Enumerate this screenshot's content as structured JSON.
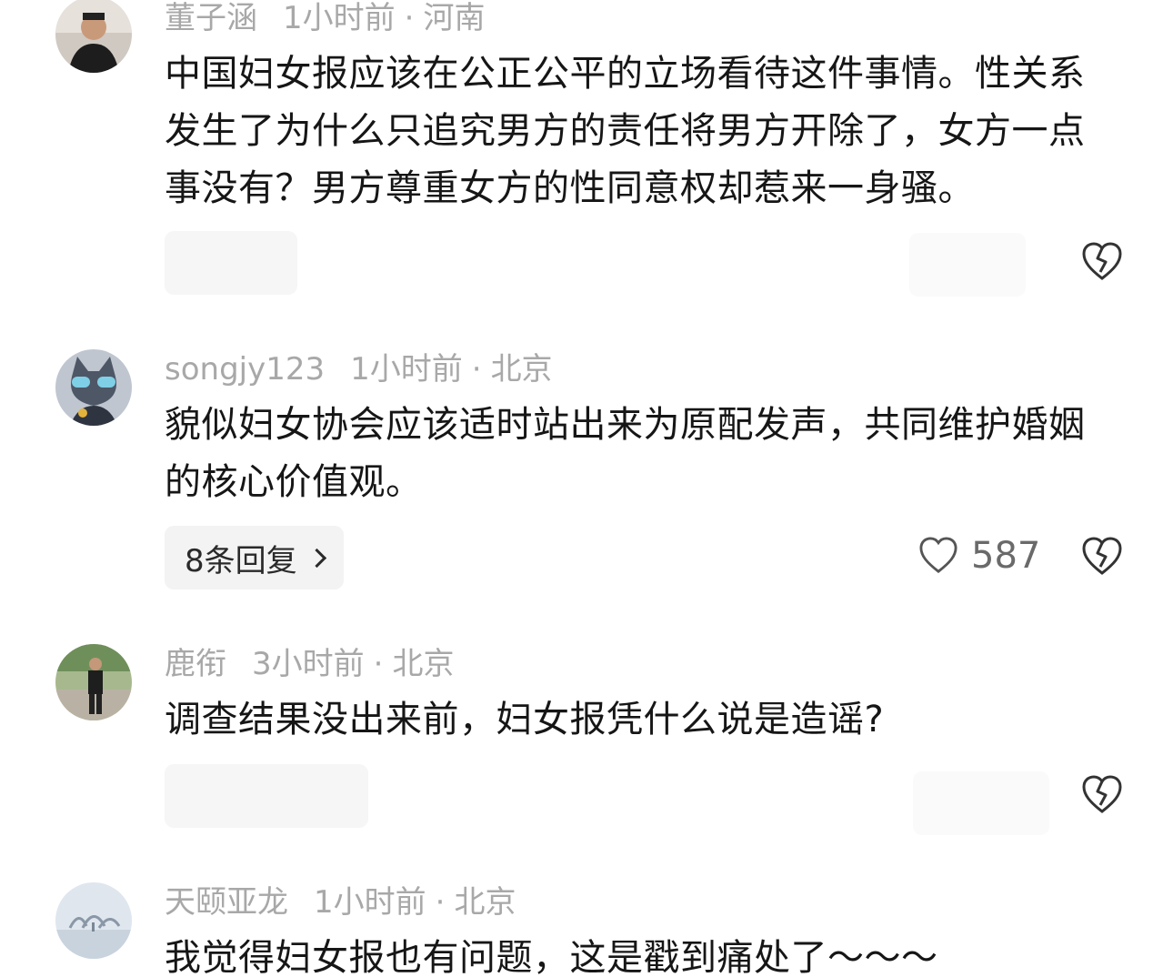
{
  "comments": [
    {
      "name": "董子涵",
      "time": "1小时前",
      "location": "河南",
      "text": "中国妇女报应该在公正公平的立场看待这件事情。性关系发生了为什么只追究男方的责任将男方开除了，女方一点事没有？男方尊重女方的性同意权却惹来一身骚。"
    },
    {
      "name": "songjy123",
      "time": "1小时前",
      "location": "北京",
      "text": "貌似妇女协会应该适时站出来为原配发声，共同维护婚姻的核心价值观。",
      "replies": "8条回复",
      "likes": "587"
    },
    {
      "name": "鹿衔",
      "time": "3小时前",
      "location": "北京",
      "text": "调查结果没出来前，妇女报凭什么说是造谣?"
    },
    {
      "name": "天颐亚龙",
      "time": "1小时前",
      "location": "北京",
      "text": "我觉得妇女报也有问题，这是戳到痛处了～～～"
    }
  ],
  "separator": "·",
  "icons": {
    "dislike": "broken-heart-icon",
    "like": "heart-icon",
    "reply_arrow": "chevron-right-icon"
  },
  "colors": {
    "meta": "#a8a8a8",
    "text": "#161616",
    "pill": "#f3f3f3"
  }
}
